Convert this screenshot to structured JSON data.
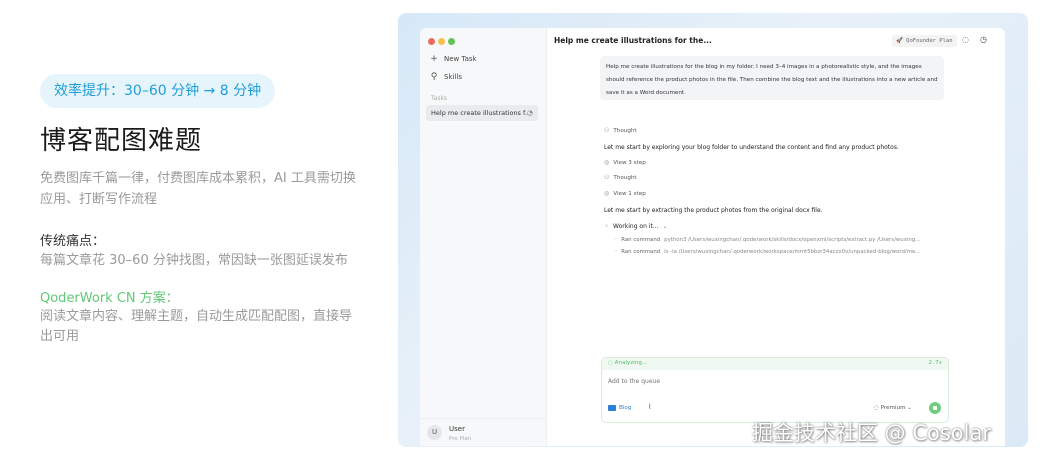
{
  "left": {
    "pill": "效率提升：30–60 分钟 → 8 分钟",
    "title": "博客配图难题",
    "description": "免费图库千篇一律，付费图库成本累积，AI 工具需切换应用、打断写作流程",
    "pain_heading": "传统痛点：",
    "pain_body": "每篇文章花 30–60 分钟找图，常因缺一张图延误发布",
    "solution_heading": "QoderWork CN 方案：",
    "solution_body": "阅读文章内容、理解主题，自动生成匹配配图，直接导出可用"
  },
  "window": {
    "traffic_lights": [
      "#ed6a5e",
      "#f4bf4f",
      "#61c554"
    ],
    "sidebar": {
      "new_task": "New Task",
      "skills": "Skills",
      "tasks_label": "Tasks",
      "task_item": "Help me create illustrations f...",
      "user_initial": "U",
      "user_name": "User",
      "user_plan": "Pro Plan"
    },
    "header": {
      "title": "Help me create illustrations for the...",
      "plan_badge": "🚀 QoFounder Plan"
    },
    "user_message": "Help me create illustrations for the blog in my folder. I need 3–4 images in a photorealistic style, and the images should reference the product photos in the file. Then combine the blog text and the illustrations into a new article and save it as a Word document.",
    "conversation": {
      "thought1": "Thought",
      "reply1": "Let me start by exploring your blog folder to understand the content and find any product photos.",
      "view1": "View 3 step",
      "thought2": "Thought",
      "view2": "View 1 step",
      "reply2": "Let me start by extracting the product photos from the original docx file.",
      "working": "Working on it...",
      "cmd1_label": "Ran command",
      "cmd1_args": "python3 /Users/wuxingchan/.qoderwork/skills/docx/openxml/scripts/extract.py /Users/wuxing...",
      "cmd2_label": "Ran command",
      "cmd2_args": "ls -la /Users/wuxingchan/.qoderwork/workspace/mmt5bbzr34aczx0v/unpacked-blog/word/me..."
    },
    "composer": {
      "status": "Analyzing...",
      "elapsed": "2.7s",
      "placeholder": "Add to the queue",
      "folder_chip": "Blog",
      "model": "Premium ⌄"
    }
  },
  "watermark": "掘金技术社区 @ Cosolar",
  "colors": {
    "accent_blue": "#1f9ed8",
    "accent_green": "#62c777",
    "frame_bg": "#dbe9f6"
  }
}
